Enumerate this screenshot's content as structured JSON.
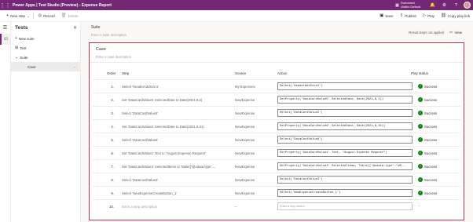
{
  "titlebar": {
    "app_title": "Power Apps | Test Studio (Preview) - Expense Report",
    "environment_label": "Environment",
    "environment_name": "Visiltic Default"
  },
  "commands": {
    "new_step": "New step",
    "record": "Record",
    "delete": "Delete",
    "save": "Save",
    "publish": "Publish",
    "play": "Play",
    "copy_play_link": "Copy play link"
  },
  "tree": {
    "title": "Tests",
    "new_suite": "New suite",
    "test_item": "Test",
    "suite_item": "Suite",
    "case_item": "Case",
    "more": "···"
  },
  "suite": {
    "title": "Suite",
    "description_placeholder": "Enter a suite description",
    "result_text": "Result steps not applied",
    "view_label": "View"
  },
  "case": {
    "title": "Case",
    "description_placeholder": "Enter a case description"
  },
  "table": {
    "headers": {
      "order": "Order",
      "step": "Step",
      "screen": "Screen",
      "action": "Action",
      "status": "Play status"
    },
    "rows": [
      {
        "order": "1.",
        "step": "Select 'HeaderAddIcon1'",
        "screen": "My Expenses",
        "action": "Select('HeaderAddIcon1')",
        "status": "Success"
      },
      {
        "order": "2.",
        "step": "Set 'DataCardValue5'.SelectedDate to Date(2021,8,2)",
        "screen": "NewExpense",
        "action": "SetProperty('DataCardValue5'.SelectedDate, Date(2021,8,2))",
        "status": "Success"
      },
      {
        "order": "3.",
        "step": "Select 'DataCardValue5'",
        "screen": "NewExpense",
        "action": "Select('DataCardValue5')",
        "status": "Success"
      },
      {
        "order": "4.",
        "step": "Set 'DataCardValue6'.SelectedDate to Date(2021,8,31)",
        "screen": "NewExpense",
        "action": "SetProperty('DataCardValue6'.SelectedDate, Date(2021,8,31))",
        "status": "Success"
      },
      {
        "order": "5.",
        "step": "Select 'DataCardValue6'",
        "screen": "NewExpense",
        "action": "Select('DataCardValue6')",
        "status": "Success"
      },
      {
        "order": "6.",
        "step": "Set 'DataCardValue1'.Text to \"August Expense Request\"",
        "screen": "NewExpense",
        "action": "SetProperty('DataCardValue1'.Text, \"August Expense Request\")",
        "status": "Success"
      },
      {
        "order": "7.",
        "step": "Set 'DataCardValue3'.SelectedItems to Table({'@odata.type':...",
        "screen": "NewExpense",
        "action": "SetProperty('DataCardValue3'.SelectedItems, Table({'@odata.type':\"#M...",
        "status": "Success"
      },
      {
        "order": "8.",
        "step": "Select 'DataCardValue3'",
        "screen": "NewExpense",
        "action": "Select('DataCardValue3')",
        "status": "Success"
      },
      {
        "order": "9.",
        "step": "Select 'NewExpenseCreateButton_1'",
        "screen": "NewExpense",
        "action": "Select('NewExpenseCreateButton_1')",
        "status": "Success"
      }
    ],
    "new_row": {
      "order": "10.",
      "step_placeholder": "Enter a step description",
      "screen": "--",
      "action_placeholder": "Enter a step action",
      "status": "--"
    }
  }
}
